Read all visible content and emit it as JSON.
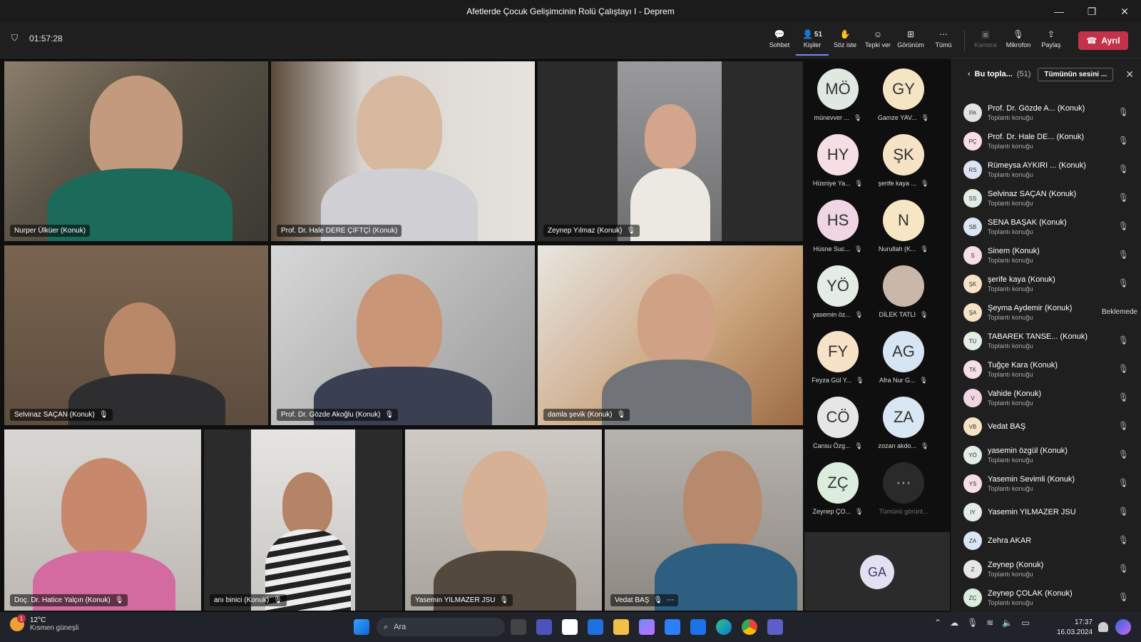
{
  "window": {
    "title": "Afetlerde Çocuk Gelişimcinin Rolü Çalıştayı I - Deprem"
  },
  "toolbar": {
    "timer": "01:57:28",
    "chat": "Sohbet",
    "people": "Kişiler",
    "people_count": "51",
    "raise_hand": "Söz iste",
    "react": "Tepki ver",
    "view": "Görünüm",
    "more": "Tümü",
    "camera": "Kamera",
    "mic": "Mikrofon",
    "share": "Paylaş",
    "leave": "Ayrıl"
  },
  "tiles": [
    {
      "name": "Nurper Ülküer (Konuk)"
    },
    {
      "name": "Prof. Dr. Hale DERE ÇİFTÇİ (Konuk)"
    },
    {
      "name": "Zeynep Yılmaz (Konuk)"
    },
    {
      "name": "Selvinaz SAÇAN (Konuk)"
    },
    {
      "name": "Prof. Dr. Gözde Akoğlu (Konuk)"
    },
    {
      "name": "damla şevik (Konuk)"
    },
    {
      "name": "Doç. Dr. Hatice Yalçın (Konuk)"
    },
    {
      "name": "anı binici (Konuk)"
    },
    {
      "name": "Yasemin YILMAZER JSU"
    },
    {
      "name": "Vedat BAŞ"
    }
  ],
  "gallery": [
    {
      "initials": "MÖ",
      "label": "münevver ...",
      "color": "#dfe9e2"
    },
    {
      "initials": "GY",
      "label": "Gamze YAV...",
      "color": "#f4e6c4"
    },
    {
      "initials": "HY",
      "label": "Hüsniye Ya...",
      "color": "#f6dfe4"
    },
    {
      "initials": "ŞK",
      "label": "şerife kaya ...",
      "color": "#f6e3c6"
    },
    {
      "initials": "HS",
      "label": "Hüsne Suc...",
      "color": "#efd6e2"
    },
    {
      "initials": "N",
      "label": "Nurullah (K...",
      "color": "#f6e6c4"
    },
    {
      "initials": "YÖ",
      "label": "yasemin öz...",
      "color": "#e4ece6"
    },
    {
      "initials": "",
      "label": "DİLEK TATLI",
      "color": "#c9b7aa"
    },
    {
      "initials": "FY",
      "label": "Feyza Gül Y...",
      "color": "#f7e2c7"
    },
    {
      "initials": "AG",
      "label": "Afra Nur G...",
      "color": "#d7e4f4"
    },
    {
      "initials": "CÖ",
      "label": "Cansu Özg...",
      "color": "#e6e6e6"
    },
    {
      "initials": "ZA",
      "label": "zozan akdo...",
      "color": "#d9e6f3"
    },
    {
      "initials": "ZÇ",
      "label": "Zeynep ÇO...",
      "color": "#dbeede"
    },
    {
      "initials": "⋯",
      "label": "Tümünü görünt...",
      "color": "#2a2a2a"
    }
  ],
  "stage_avatar": {
    "initials": "GA"
  },
  "panel": {
    "title": "Bu topla...",
    "count": "(51)",
    "mute_all": "Tümünün sesini ...",
    "participants": [
      {
        "initials": "PA",
        "name": "Prof. Dr. Gözde A... (Konuk)",
        "role": "Toplantı konuğu",
        "color": "#e3e3e3"
      },
      {
        "initials": "PÇ",
        "name": "Prof. Dr. Hale DE... (Konuk)",
        "role": "Toplantı konuğu",
        "color": "#f6dfe4"
      },
      {
        "initials": "RS",
        "name": "Rümeysa AYKIRI ... (Konuk)",
        "role": "Toplantı konuğu",
        "color": "#dfe2f3"
      },
      {
        "initials": "SS",
        "name": "Selvinaz SAÇAN (Konuk)",
        "role": "Toplantı konuğu",
        "color": "#e4ece6"
      },
      {
        "initials": "SB",
        "name": "SENA BAŞAK (Konuk)",
        "role": "Toplantı konuğu",
        "color": "#d9e6f3"
      },
      {
        "initials": "S",
        "name": "Sinem (Konuk)",
        "role": "Toplantı konuğu",
        "color": "#f6dfe4"
      },
      {
        "initials": "ŞK",
        "name": "şerife kaya (Konuk)",
        "role": "Toplantı konuğu",
        "color": "#f6e3c6"
      },
      {
        "initials": "ŞA",
        "name": "Şeyma Aydemir (Konuk)",
        "role": "Toplantı konuğu",
        "color": "#f6e3c6",
        "status": "Beklemede"
      },
      {
        "initials": "TU",
        "name": "TABAREK TANSE... (Konuk)",
        "role": "Toplantı konuğu",
        "color": "#e4ece6"
      },
      {
        "initials": "TK",
        "name": "Tuğçe Kara (Konuk)",
        "role": "Toplantı konuğu",
        "color": "#f6dfe4"
      },
      {
        "initials": "V",
        "name": "Vahide (Konuk)",
        "role": "Toplantı konuğu",
        "color": "#efd6e2"
      },
      {
        "initials": "VB",
        "name": "Vedat BAŞ",
        "role": "",
        "color": "#f6e3c6"
      },
      {
        "initials": "YÖ",
        "name": "yasemin özgül (Konuk)",
        "role": "Toplantı konuğu",
        "color": "#e4ece6"
      },
      {
        "initials": "YS",
        "name": "Yasemin Sevimli (Konuk)",
        "role": "Toplantı konuğu",
        "color": "#f6dfe4"
      },
      {
        "initials": "IY",
        "name": "Yasemin YILMAZER JSU",
        "role": "",
        "color": "#e4ece6"
      },
      {
        "initials": "ZA",
        "name": "Zehra AKAR",
        "role": "",
        "color": "#d9e6f3"
      },
      {
        "initials": "Z",
        "name": "Zeynep (Konuk)",
        "role": "Toplantı konuğu",
        "color": "#e6e6e6"
      },
      {
        "initials": "ZÇ",
        "name": "Zeynep ÇOLAK (Konuk)",
        "role": "Toplantı konuğu",
        "color": "#dbeede"
      }
    ]
  },
  "taskbar": {
    "weather_temp": "12°C",
    "weather_desc": "Kısmen güneşli",
    "weather_badge": "1",
    "search_placeholder": "Ara",
    "time": "17:37",
    "date": "16.03.2024"
  },
  "colors": {
    "accent": "#7f85f5",
    "leave": "#c4314b"
  }
}
